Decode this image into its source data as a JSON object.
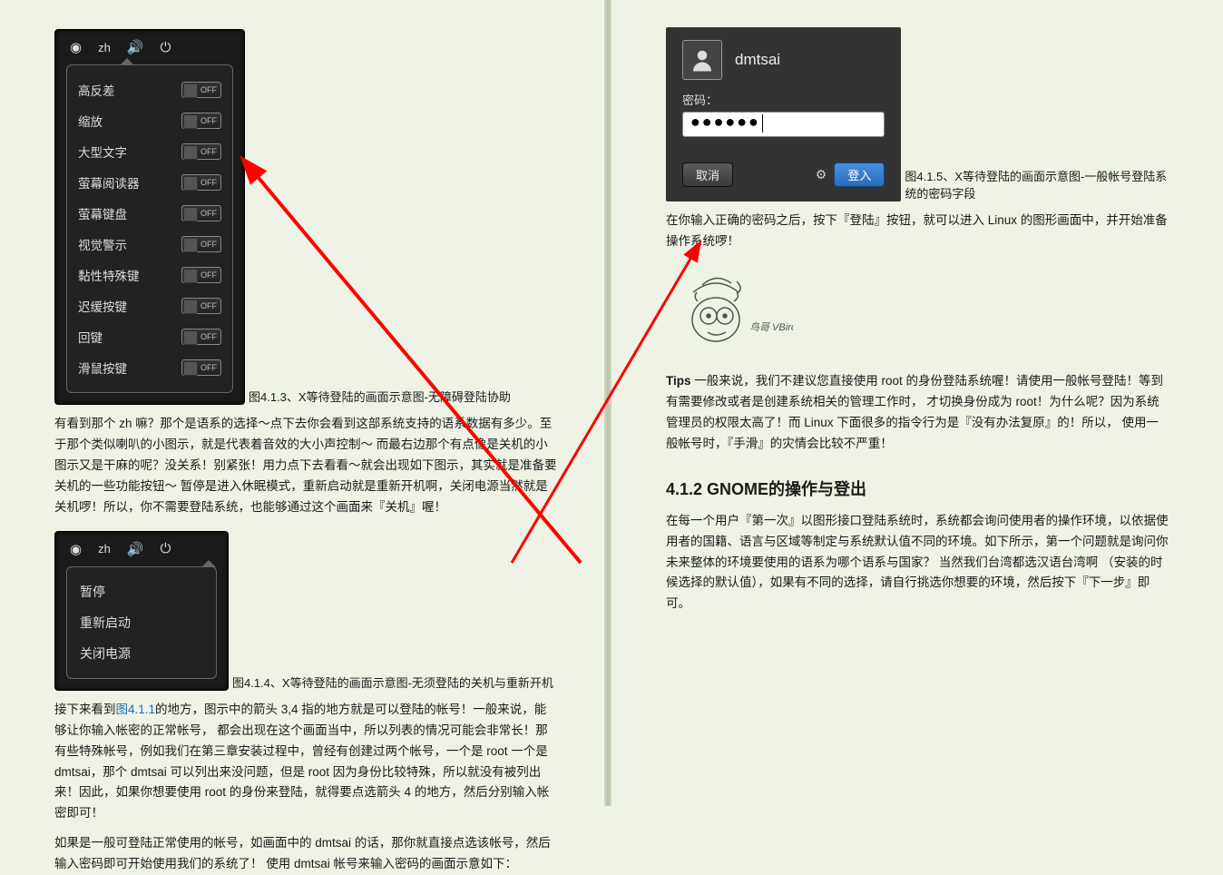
{
  "left": {
    "topbar": {
      "lang": "zh"
    },
    "toggles": {
      "items": [
        "高反差",
        "缩放",
        "大型文字",
        "萤幕阅读器",
        "萤幕键盘",
        "视觉警示",
        "黏性特殊键",
        "迟缓按键",
        "回键",
        "滑鼠按键"
      ],
      "off": "OFF"
    },
    "caption413": "图4.1.3、X等待登陆的画面示意图-无障碍登陆协助",
    "para1": "有看到那个 zh 嘛？那个是语系的选择～点下去你会看到这部系统支持的语系数据有多少。至于那个类似喇叭的小图示，就是代表着音效的大小声控制～ 而最右边那个有点像是关机的小图示又是干麻的呢？没关系！别紧张！用力点下去看看～就会出现如下图示，其实就是准备要关机的一些功能按钮～ 暂停是进入休眠模式，重新启动就是重新开机啊，关闭电源当然就是关机啰！所以，你不需要登陆系统，也能够通过这个画面来『关机』喔！",
    "power_items": [
      "暂停",
      "重新启动",
      "关闭电源"
    ],
    "caption414": "图4.1.4、X等待登陆的画面示意图-无须登陆的关机与重新开机",
    "para2a": "接下来看到",
    "para2link": "图4.1.1",
    "para2b": "的地方，图示中的箭头 3,4 指的地方就是可以登陆的帐号！一般来说，能够让你输入帐密的正常帐号， 都会出现在这个画面当中，所以列表的情况可能会非常长！那有些特殊帐号，例如我们在第三章安装过程中，曾经有创建过两个帐号，一个是 root 一个是 dmtsai，那个 dmtsai 可以列出来没问题，但是 root 因为身份比较特殊，所以就没有被列出来！因此，如果你想要使用 root 的身份来登陆，就得要点选箭头 4 的地方，然后分别输入帐密即可！",
    "para3": "如果是一般可登陆正常使用的帐号，如画面中的 dmtsai 的话，那你就直接点选该帐号，然后输入密码即可开始使用我们的系统了！ 使用 dmtsai 帐号来输入密码的画面示意如下："
  },
  "right": {
    "login": {
      "username": "dmtsai",
      "pw_label": "密码：",
      "pw_value": "●●●●●●",
      "cancel": "取消",
      "submit": "登入"
    },
    "caption415": "图4.1.5、X等待登陆的画面示意图-一般帐号登陆系统的密码字段",
    "para1": "在你输入正确的密码之后，按下『登陆』按钮，就可以进入 Linux 的图形画面中，并开始准备操作系统啰！",
    "doodle_label": "鸟哥 VBird",
    "tips_label": "Tips",
    "tips_body": " 一般来说，我们不建议您直接使用 root 的身份登陆系统喔！请使用一般帐号登陆！等到有需要修改或者是创建系统相关的管理工作时， 才切换身份成为 root！为什么呢？因为系统管理员的权限太高了！而 Linux 下面很多的指令行为是『没有办法复原』的！所以， 使用一般帐号时，『手滑』的灾情会比较不严重！",
    "heading412": "4.1.2 GNOME的操作与登出",
    "para2": "在每一个用户『第一次』以图形接口登陆系统时，系统都会询问使用者的操作环境，以依据使用者的国籍、语言与区域等制定与系统默认值不同的环境。如下所示，第一个问题就是询问你未来整体的环境要使用的语系为哪个语系与国家？ 当然我们台湾都选汉语台湾啊 （安装的时候选择的默认值），如果有不同的选择，请自行挑选你想要的环境，然后按下『下一步』即可。"
  }
}
